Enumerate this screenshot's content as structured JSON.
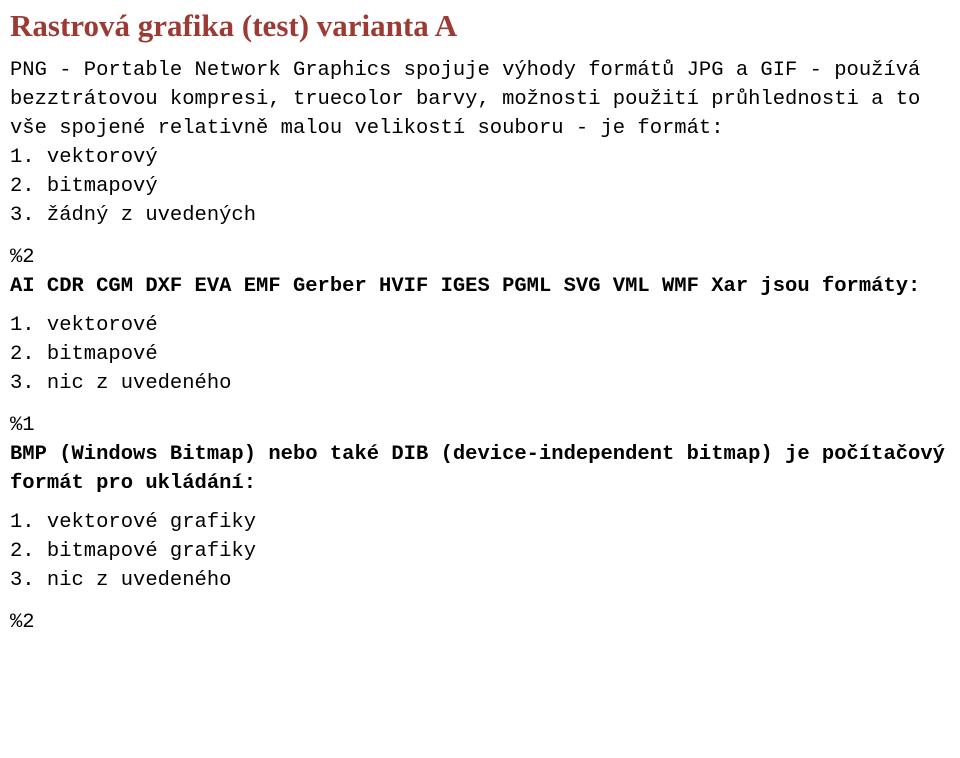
{
  "document": {
    "title": "Rastrová grafika (test) varianta A",
    "title_color": "#9c3a33",
    "text_color": "#000000",
    "background_color": "#ffffff"
  },
  "questions": [
    {
      "id": "q1",
      "prompt": "PNG - Portable Network Graphics spojuje výhody formátů JPG a GIF - používá bezztrátovou kompresi, truecolor barvy, možnosti použití průhlednosti a to vše spojené relativně malou velikostí souboru - je formát:",
      "bold": false,
      "options": [
        "1. vektorový",
        "2. bitmapový",
        "3. žádný z uvedených"
      ],
      "answer_marker": "%2"
    },
    {
      "id": "q2",
      "prompt": "AI CDR CGM DXF EVA EMF Gerber HVIF IGES PGML SVG VML WMF Xar jsou formáty:",
      "bold": true,
      "options": [
        "1. vektorové",
        "2. bitmapové",
        "3. nic z uvedeného"
      ],
      "answer_marker": "%1"
    },
    {
      "id": "q3",
      "prompt": "BMP (Windows Bitmap) nebo také DIB (device-independent bitmap) je počítačový formát pro ukládání:",
      "bold": true,
      "options": [
        "1. vektorové grafiky",
        "2. bitmapové grafiky",
        "3. nic z uvedeného"
      ],
      "answer_marker": "%2"
    }
  ]
}
